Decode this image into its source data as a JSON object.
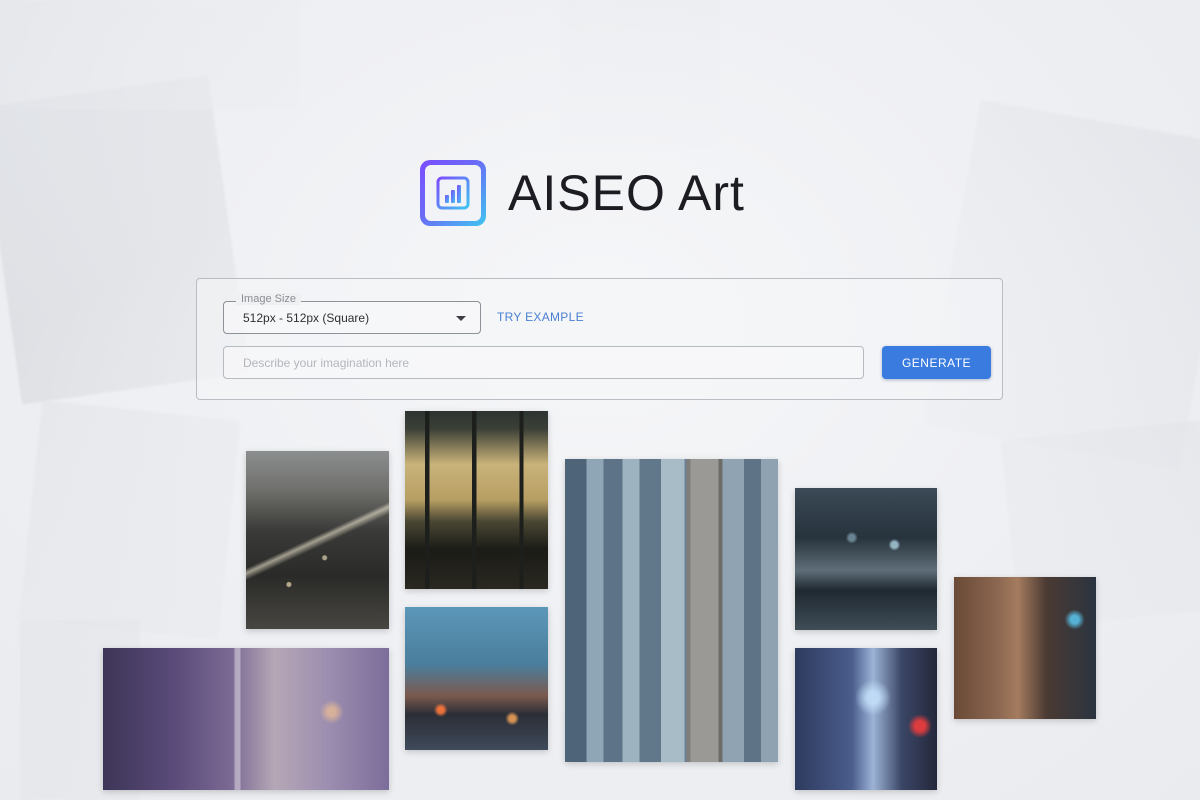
{
  "brand": {
    "title": "AISEO Art",
    "logo_icon": "bar-chart-icon",
    "colors": {
      "gradient_start": "#7b4dff",
      "gradient_end": "#3fc5f0"
    }
  },
  "form": {
    "image_size_label": "Image Size",
    "image_size_value": "512px - 512px (Square)",
    "try_example": "TRY EXAMPLE",
    "prompt_placeholder": "Describe your imagination here",
    "prompt_value": "",
    "generate_label": "GENERATE"
  },
  "colors": {
    "accent": "#3a7be0",
    "link": "#4a7fd1"
  },
  "gallery": [
    {
      "name": "night-city-aerial-image"
    },
    {
      "name": "office-window-interior-image"
    },
    {
      "name": "blue-skyscrapers-tower-image"
    },
    {
      "name": "rainy-cyberpunk-street-image"
    },
    {
      "name": "futuristic-building-wall-image"
    },
    {
      "name": "purple-glass-city-image"
    },
    {
      "name": "street-corner-city-image"
    },
    {
      "name": "neon-alley-image"
    }
  ]
}
